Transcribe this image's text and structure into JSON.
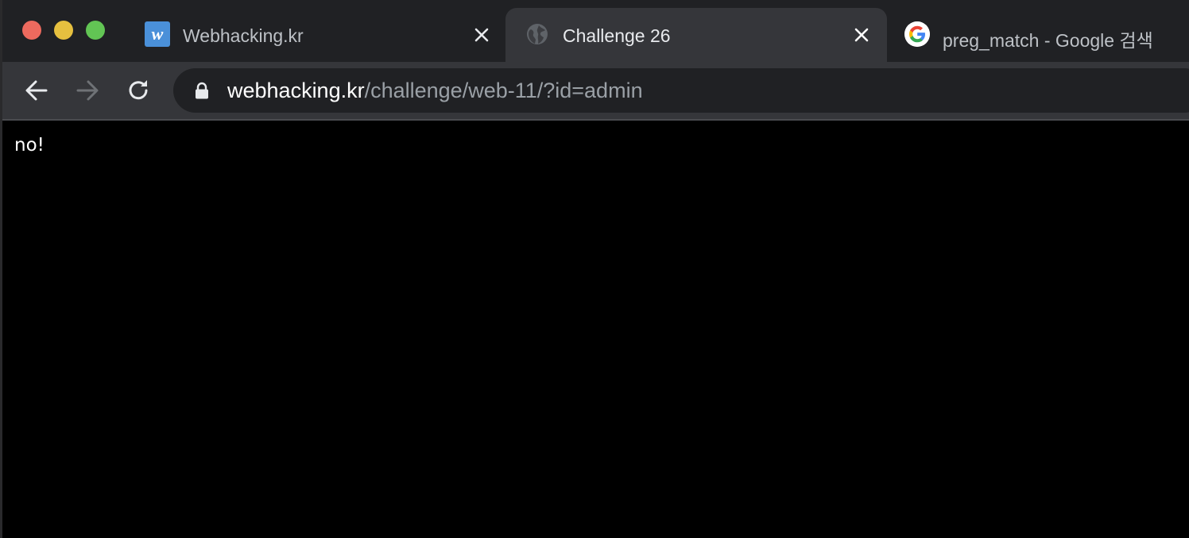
{
  "window": {
    "traffic_lights": [
      "close",
      "minimize",
      "zoom"
    ]
  },
  "tabs": [
    {
      "title": "Webhacking.kr",
      "favicon": "webhacking-w-icon",
      "favicon_text": "w",
      "active": false
    },
    {
      "title": "Challenge 26",
      "favicon": "globe-icon",
      "active": true
    },
    {
      "title": "preg_match - Google 검색",
      "favicon": "google-g-icon",
      "active": false
    }
  ],
  "toolbar": {
    "back": "arrow-left-icon",
    "forward": "arrow-right-icon",
    "reload": "reload-icon"
  },
  "address_bar": {
    "host": "webhacking.kr",
    "path": "/challenge/web-11/?id=admin",
    "secure_icon": "lock-icon"
  },
  "page": {
    "body_text": "no!"
  },
  "colors": {
    "tabstrip_bg": "#202124",
    "active_tab_bg": "#35363a",
    "omnibox_bg": "#202124",
    "page_bg": "#000000",
    "page_text": "#ffffff"
  }
}
